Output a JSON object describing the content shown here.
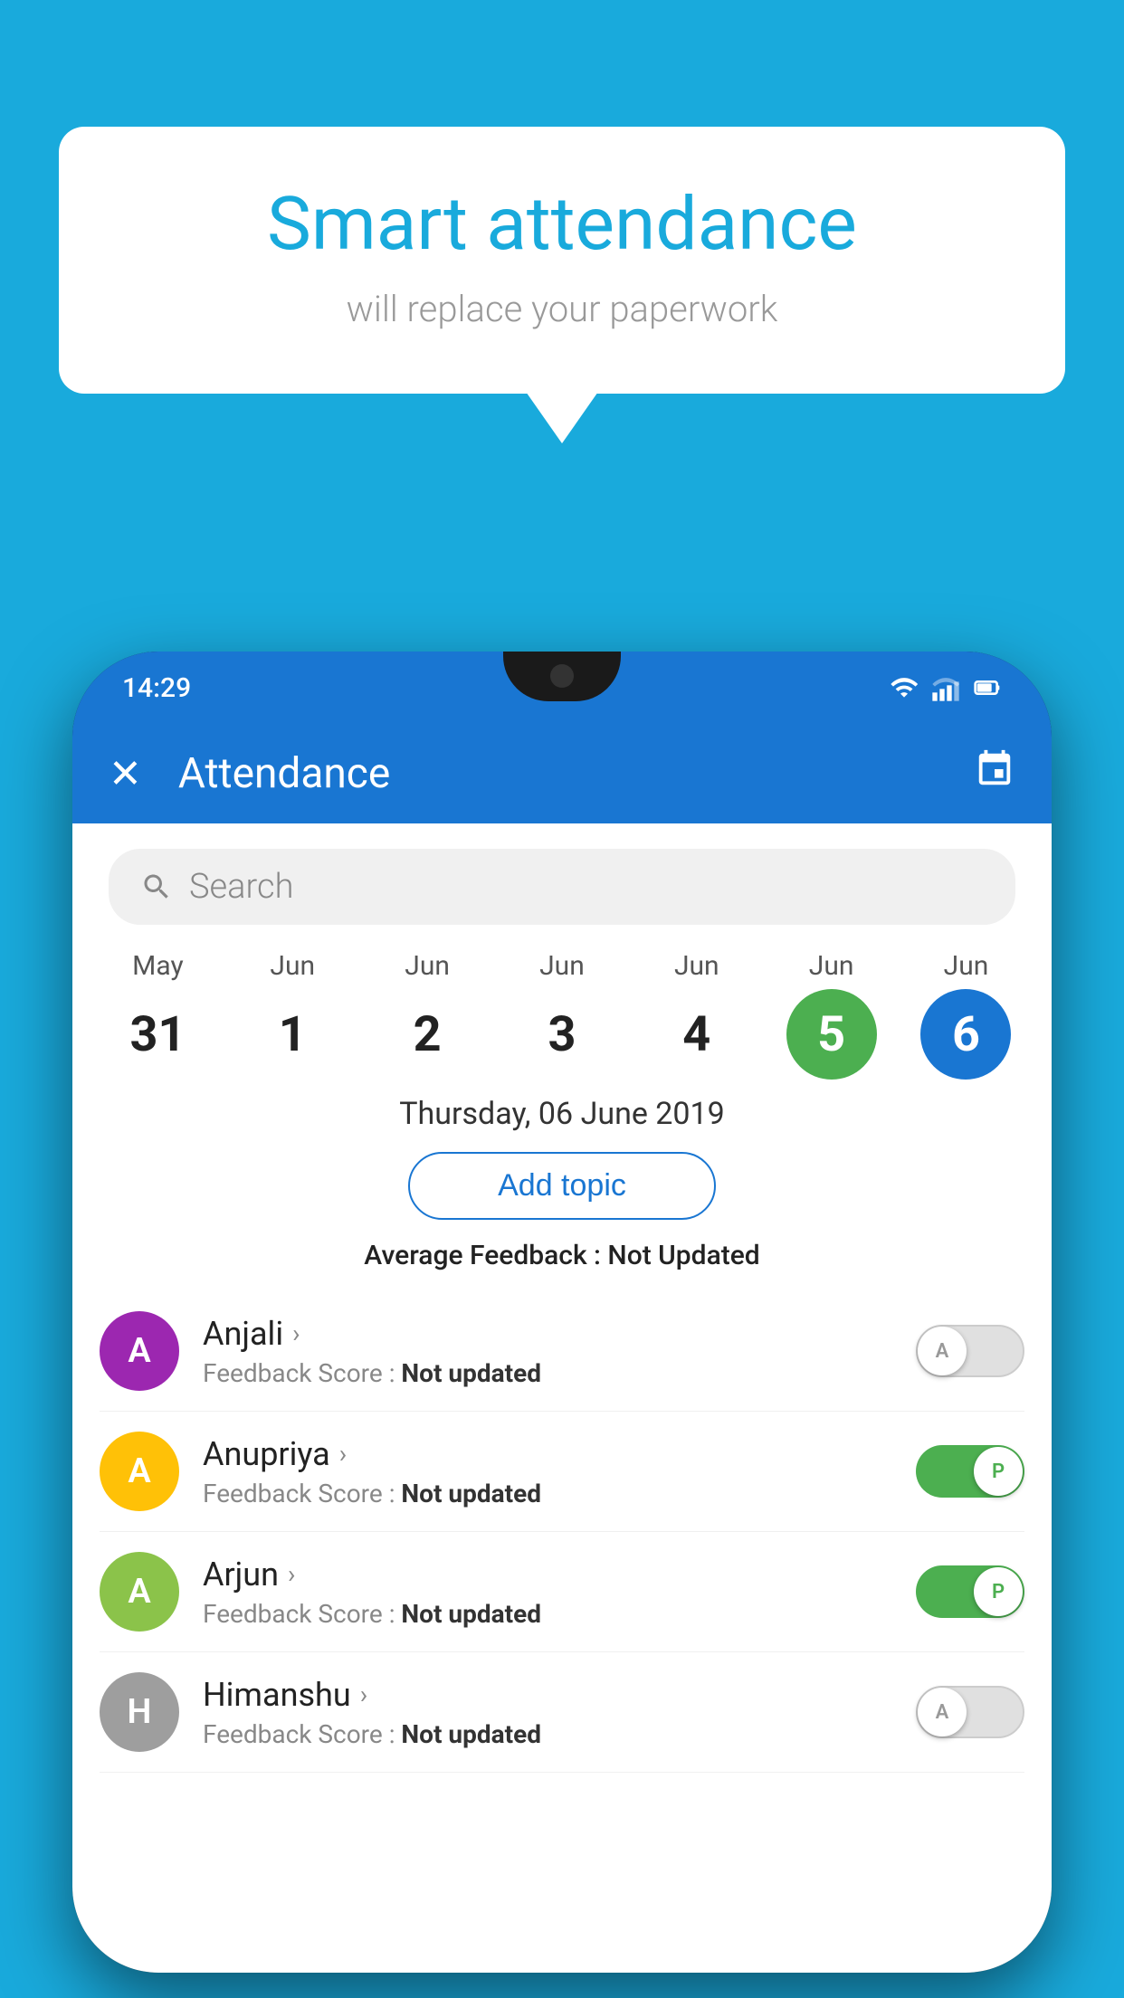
{
  "background_color": "#19AADC",
  "speech_bubble": {
    "title": "Smart attendance",
    "subtitle": "will replace your paperwork"
  },
  "status_bar": {
    "time": "14:29"
  },
  "app_header": {
    "title": "Attendance"
  },
  "search": {
    "placeholder": "Search"
  },
  "calendar": {
    "months": [
      "May",
      "Jun",
      "Jun",
      "Jun",
      "Jun",
      "Jun",
      "Jun"
    ],
    "days": [
      "31",
      "1",
      "2",
      "3",
      "4",
      "5",
      "6"
    ],
    "today_index": 5,
    "selected_index": 6
  },
  "selected_date": "Thursday, 06 June 2019",
  "add_topic_label": "Add topic",
  "avg_feedback": {
    "label": "Average Feedback : ",
    "value": "Not Updated"
  },
  "students": [
    {
      "name": "Anjali",
      "avatar_letter": "A",
      "avatar_color": "#9C27B0",
      "feedback_label": "Feedback Score : ",
      "feedback_value": "Not updated",
      "toggle_state": "off",
      "toggle_letter": "A"
    },
    {
      "name": "Anupriya",
      "avatar_letter": "A",
      "avatar_color": "#FFC107",
      "feedback_label": "Feedback Score : ",
      "feedback_value": "Not updated",
      "toggle_state": "on",
      "toggle_letter": "P"
    },
    {
      "name": "Arjun",
      "avatar_letter": "A",
      "avatar_color": "#8BC34A",
      "feedback_label": "Feedback Score : ",
      "feedback_value": "Not updated",
      "toggle_state": "on",
      "toggle_letter": "P"
    },
    {
      "name": "Himanshu",
      "avatar_letter": "H",
      "avatar_color": "#9E9E9E",
      "feedback_label": "Feedback Score : ",
      "feedback_value": "Not updated",
      "toggle_state": "off",
      "toggle_letter": "A"
    }
  ]
}
